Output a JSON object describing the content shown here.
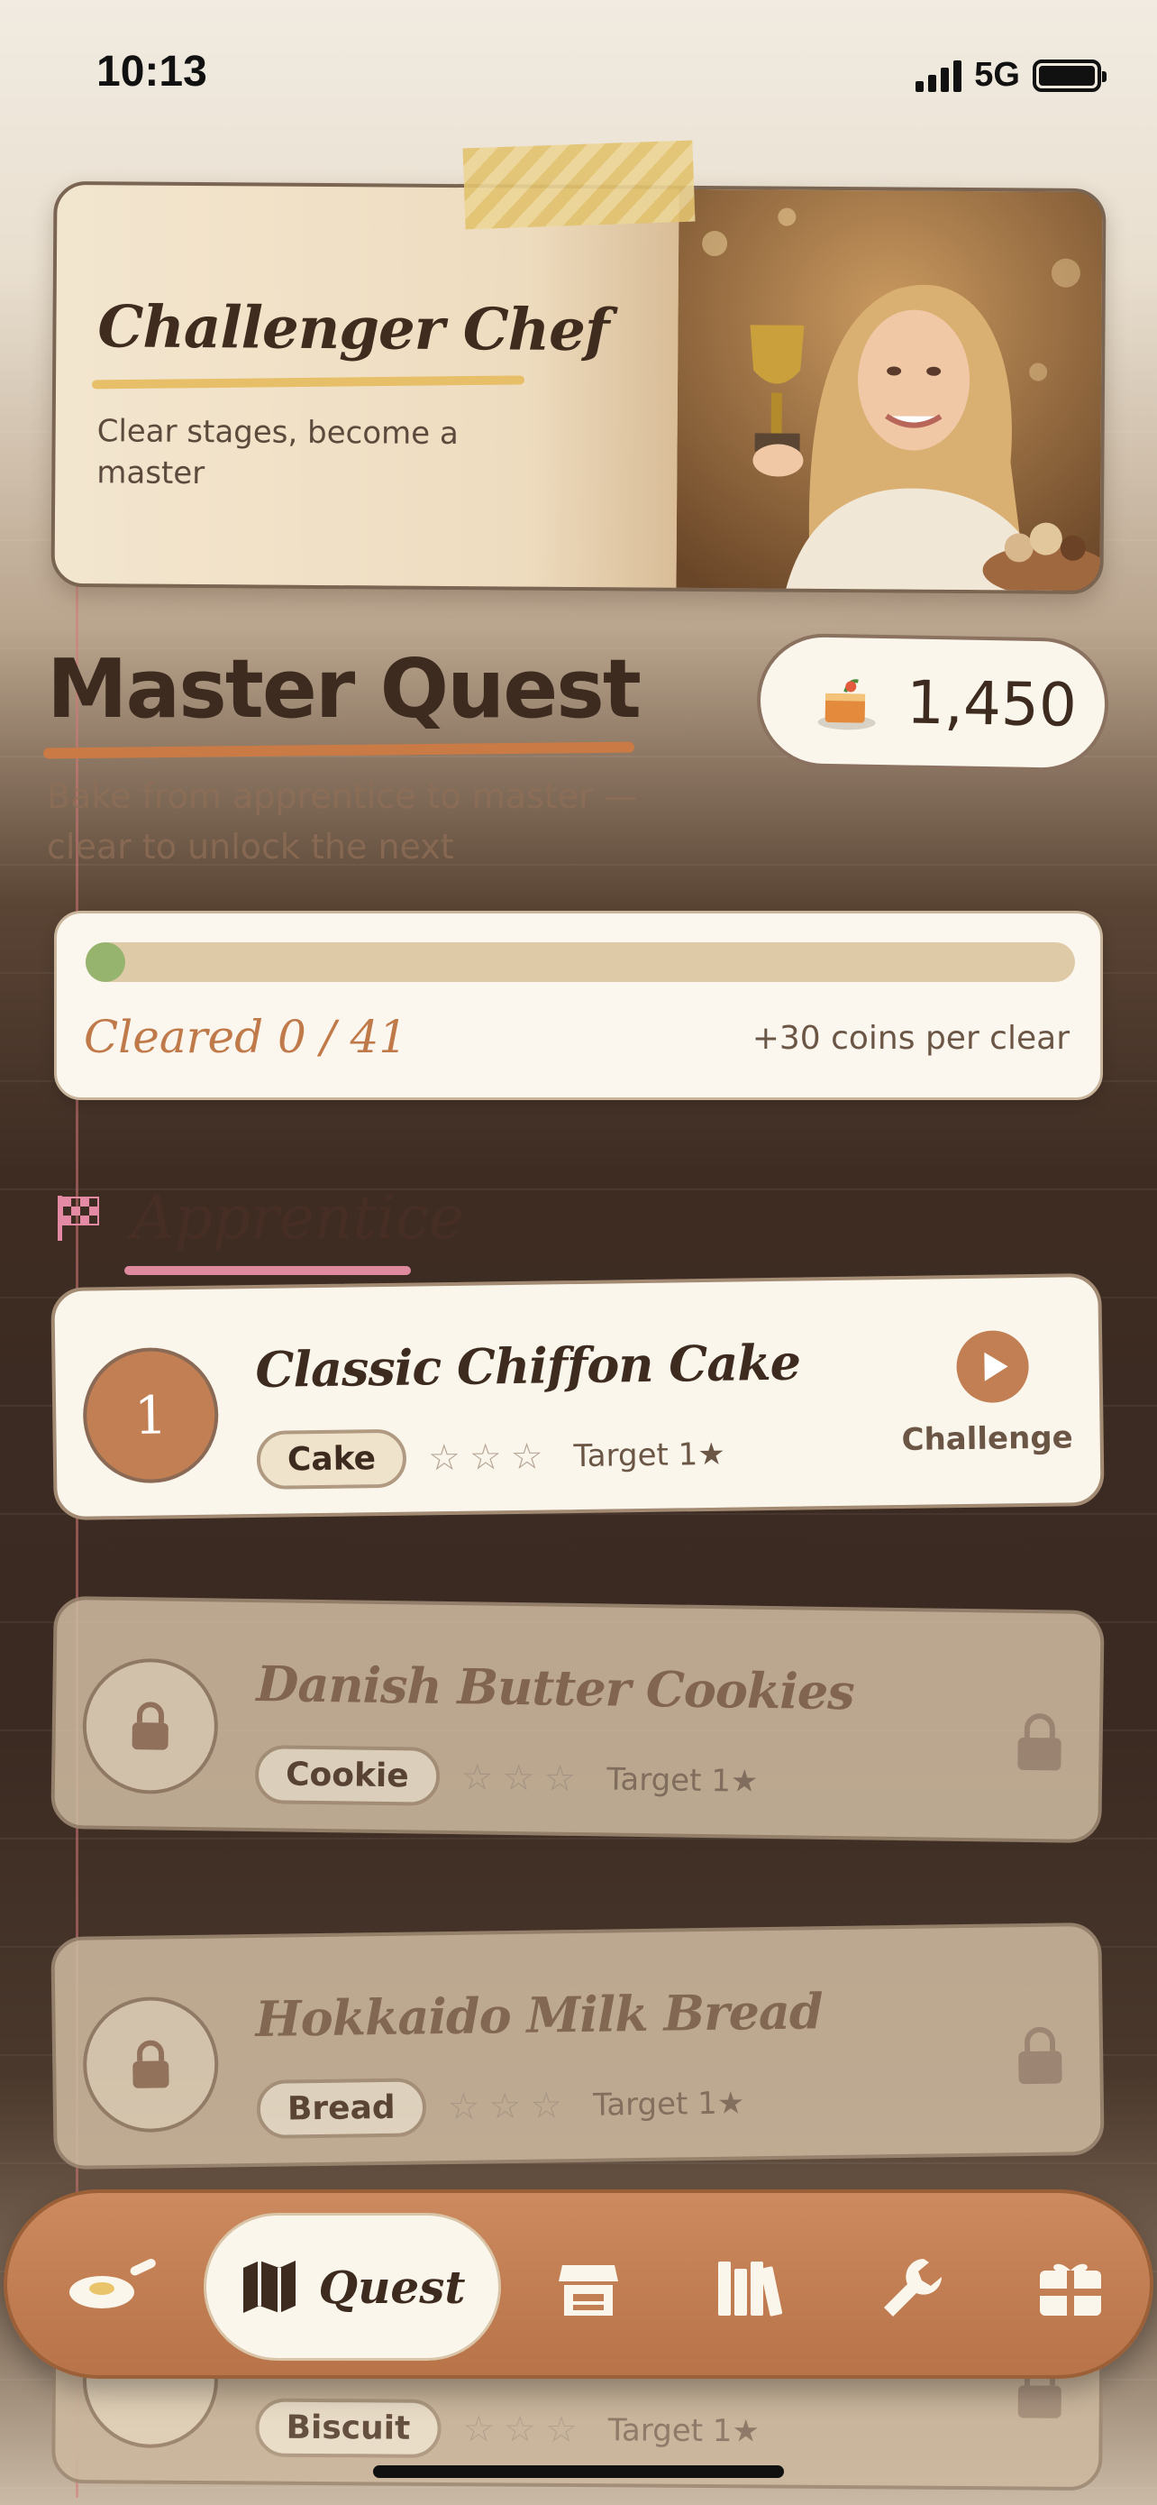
{
  "status": {
    "time": "10:13",
    "network": "5G"
  },
  "hero": {
    "title": "Challenger Chef",
    "subtitle": "Clear stages, become a master"
  },
  "header": {
    "title": "Master Quest",
    "subtitle": "Bake from apprentice to master — clear to unlock the next",
    "coins": "1,450"
  },
  "progress": {
    "cleared_label": "Cleared 0 / 41",
    "reward_label": "+30 coins per clear",
    "fraction": 0
  },
  "section": {
    "title": "Apprentice"
  },
  "stages": [
    {
      "number": "1",
      "name": "Classic Chiffon Cake",
      "tag": "Cake",
      "stars": "☆☆☆",
      "target": "Target 1★",
      "action": "Challenge",
      "locked": false
    },
    {
      "name": "Danish Butter Cookies",
      "tag": "Cookie",
      "stars": "☆☆☆",
      "target": "Target 1★",
      "locked": true
    },
    {
      "name": "Hokkaido Milk Bread",
      "tag": "Bread",
      "stars": "☆☆☆",
      "target": "Target 1★",
      "locked": true
    },
    {
      "name": "",
      "tag": "Biscuit",
      "stars": "☆☆☆",
      "target": "Target 1★",
      "locked": true
    }
  ],
  "nav": {
    "items": [
      {
        "icon": "frying-pan-icon"
      },
      {
        "icon": "map-icon",
        "label": "Quest",
        "active": true
      },
      {
        "icon": "shop-icon"
      },
      {
        "icon": "books-icon"
      },
      {
        "icon": "wrench-icon"
      },
      {
        "icon": "gift-icon"
      }
    ]
  }
}
